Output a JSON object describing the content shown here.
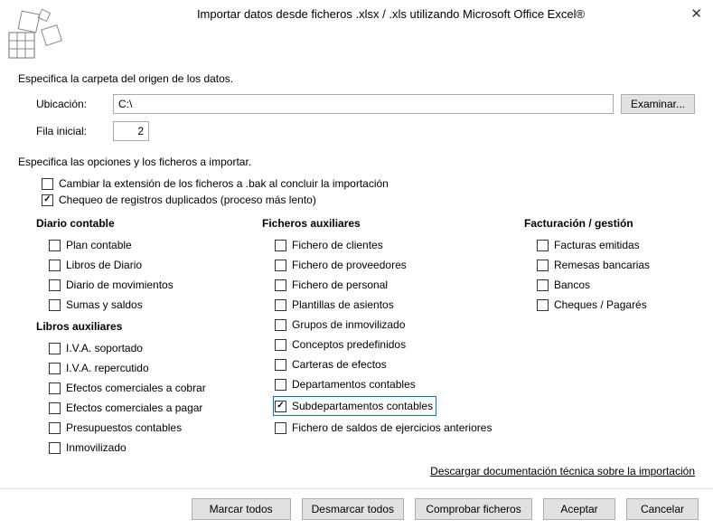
{
  "header": {
    "title": "Importar datos desde ficheros .xlsx / .xls utilizando Microsoft Office Excel®"
  },
  "section1": {
    "label": "Especifica la carpeta del origen de los datos.",
    "location_label": "Ubicación:",
    "location_value": "C:\\",
    "browse": "Examinar...",
    "startrow_label": "Fila inicial:",
    "startrow_value": "2"
  },
  "section2": {
    "label": "Especifica las opciones y los ficheros a importar.",
    "opt_bak": "Cambiar la extensión de los ficheros a .bak al concluir la importación",
    "opt_dup": "Chequeo de registros duplicados (proceso más lento)"
  },
  "groups": {
    "diario": {
      "title": "Diario contable",
      "items": [
        "Plan contable",
        "Libros de Diario",
        "Diario de movimientos",
        "Sumas y saldos"
      ]
    },
    "libros": {
      "title": "Libros auxiliares",
      "items": [
        "I.V.A. soportado",
        "I.V.A. repercutido",
        "Efectos comerciales a cobrar",
        "Efectos comerciales a pagar",
        "Presupuestos contables",
        "Inmovilizado"
      ]
    },
    "ficheros": {
      "title": "Ficheros auxiliares",
      "items": [
        "Fichero de clientes",
        "Fichero de proveedores",
        "Fichero de personal",
        "Plantillas de asientos",
        "Grupos de inmovilizado",
        "Conceptos predefinidos",
        "Carteras de efectos",
        "Departamentos contables",
        "Subdepartamentos contables",
        "Fichero de saldos de ejercicios anteriores"
      ]
    },
    "fact": {
      "title": "Facturación / gestión",
      "items": [
        "Facturas emitidas",
        "Remesas bancarias",
        "Bancos",
        "Cheques / Pagarés"
      ]
    }
  },
  "link": "Descargar documentación técnica sobre la importación",
  "buttons": {
    "mark_all": "Marcar todos",
    "unmark_all": "Desmarcar todos",
    "check_files": "Comprobar ficheros",
    "accept": "Aceptar",
    "cancel": "Cancelar"
  }
}
